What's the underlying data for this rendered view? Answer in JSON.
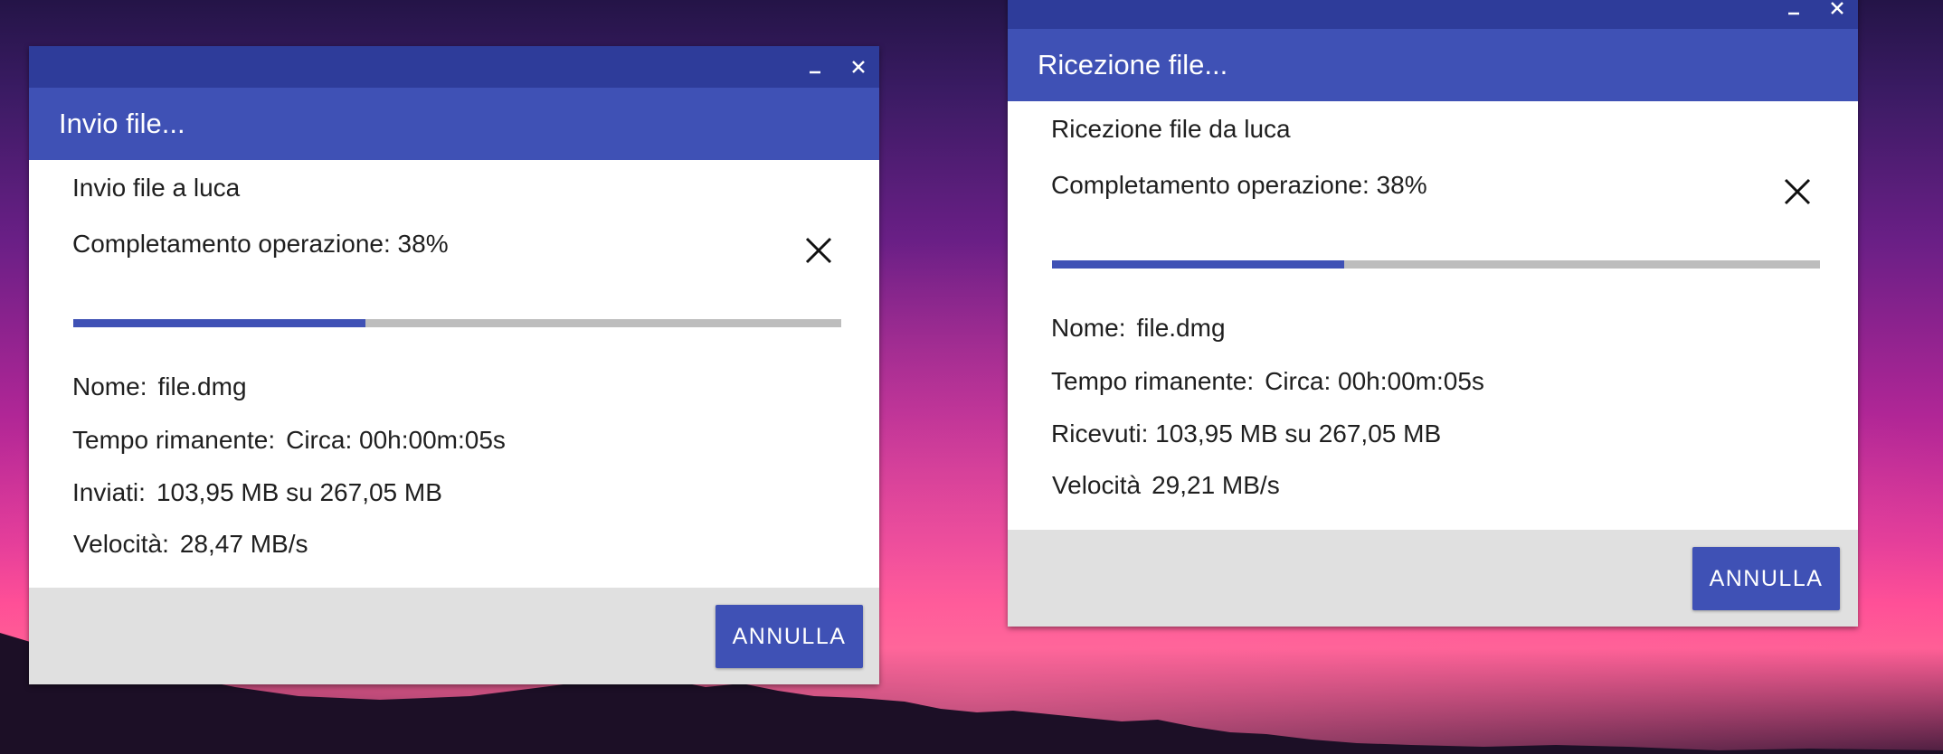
{
  "desktop": {
    "wallpaper": "sunset-mountains"
  },
  "send_window": {
    "header_title": "Invio file...",
    "message": "Invio file a luca",
    "completion_label": "Completamento operazione: 38%",
    "progress_fraction": 0.38,
    "name_label": "Nome:",
    "name_value": "file.dmg",
    "time_label": "Tempo rimanente:",
    "time_value": "Circa: 00h:00m:05s",
    "transferred_label": "Inviati:",
    "transferred_value": "103,95 MB su 267,05 MB",
    "speed_label": "Velocità:",
    "speed_value": "28,47 MB/s",
    "cancel_label": "ANNULLA"
  },
  "receive_window": {
    "header_title": "Ricezione file...",
    "message": "Ricezione file da luca",
    "completion_label": "Completamento operazione: 38%",
    "progress_fraction": 0.38,
    "name_label": "Nome:",
    "name_value": "file.dmg",
    "time_label": "Tempo rimanente:",
    "time_value": "Circa: 00h:00m:05s",
    "transferred_text": "Ricevuti: 103,95 MB su 267,05 MB",
    "speed_label": "Velocità",
    "speed_value": "29,21 MB/s",
    "cancel_label": "ANNULLA"
  },
  "colors": {
    "titlebar": "#2e3c9a",
    "header": "#3f51b5",
    "accent": "#3f51b5",
    "progress_track": "#bdbdbd",
    "footer": "#e0e0e0"
  },
  "icons": {
    "minimize": "minimize-icon",
    "window_close": "close-icon",
    "cancel_transfer": "close-icon"
  }
}
